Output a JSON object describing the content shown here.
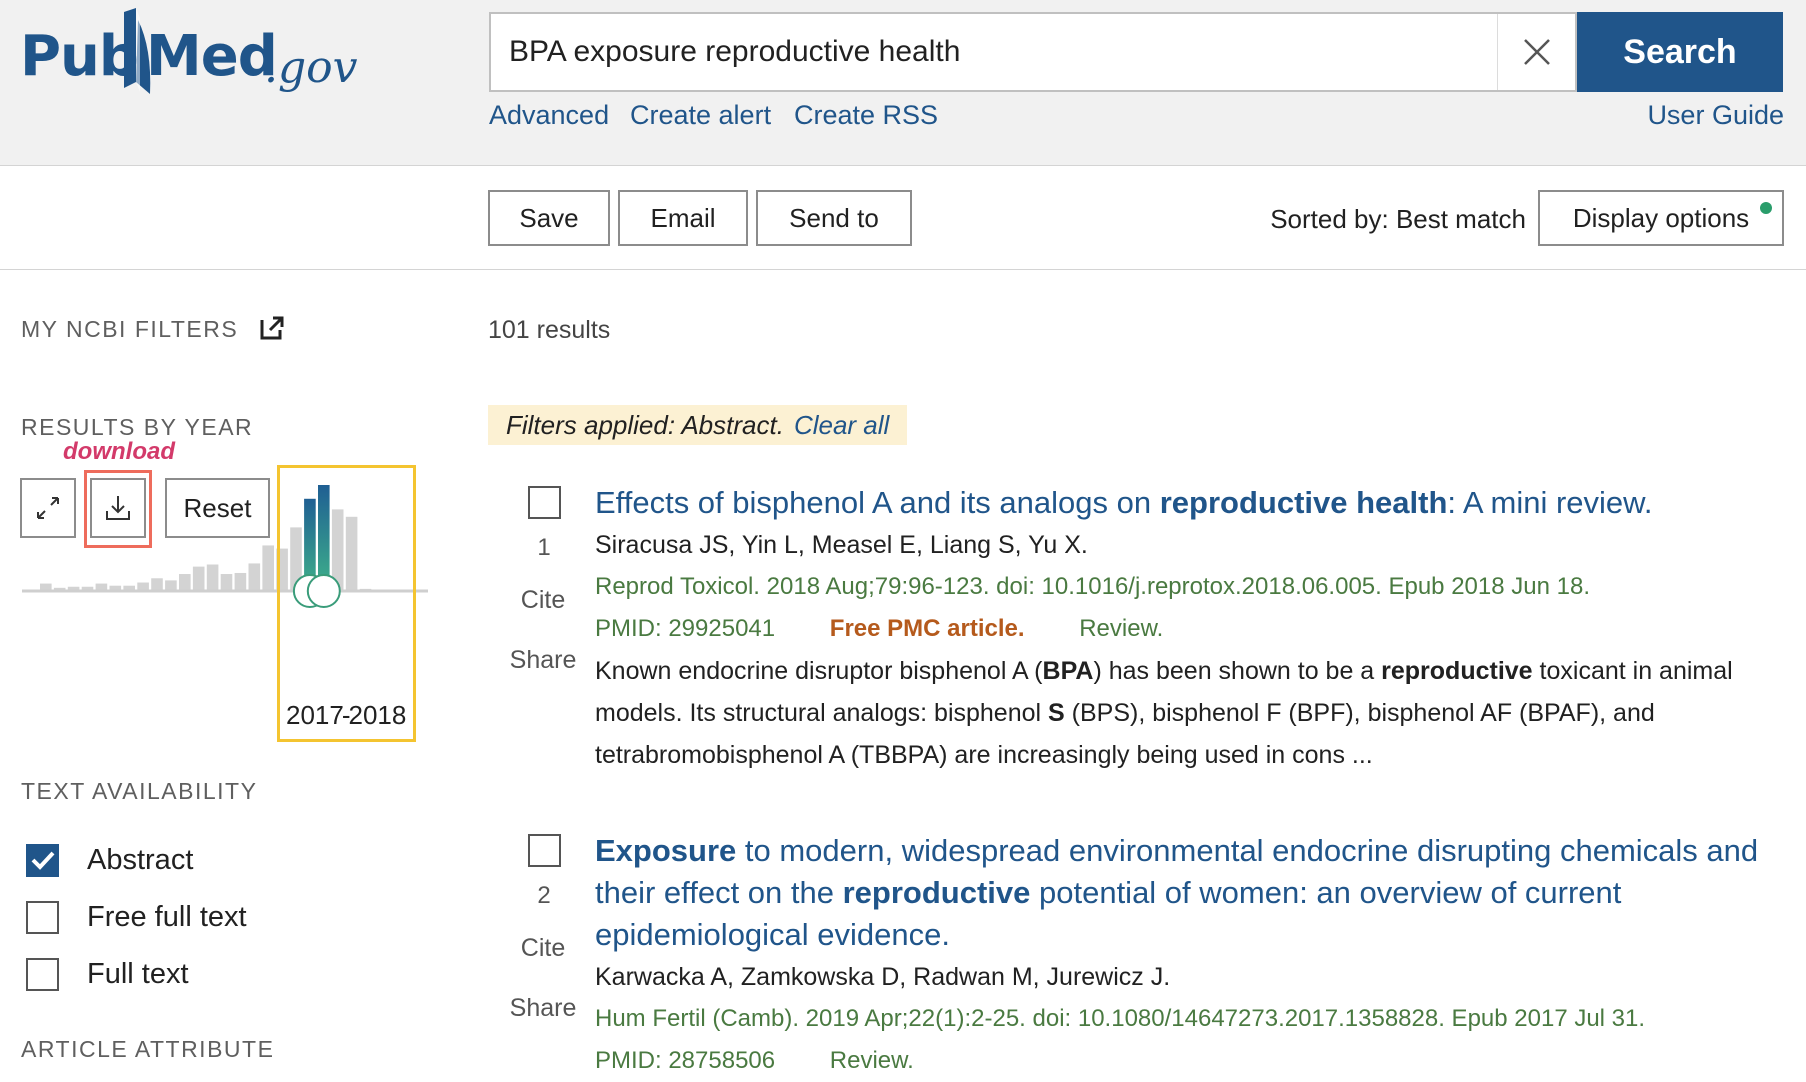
{
  "logo": {
    "pub": "Pub",
    "med": "Med",
    "gov": ".gov"
  },
  "search": {
    "query": "BPA exposure reproductive health",
    "button_label": "Search"
  },
  "header_links": {
    "advanced": "Advanced",
    "create_alert": "Create alert",
    "create_rss": "Create RSS",
    "user_guide": "User Guide"
  },
  "toolbar": {
    "save": "Save",
    "email": "Email",
    "send_to": "Send to",
    "sorted_by": "Sorted by: Best match",
    "display_options": "Display options"
  },
  "sidebar": {
    "my_ncbi_filters": "MY NCBI FILTERS",
    "results_by_year": "RESULTS BY YEAR",
    "download_annotation": "download",
    "reset": "Reset",
    "year_range_start": "2017",
    "year_range_end": "2018",
    "text_availability": "TEXT AVAILABILITY",
    "filters": [
      {
        "label": "Abstract",
        "checked": true
      },
      {
        "label": "Free full text",
        "checked": false
      },
      {
        "label": "Full text",
        "checked": false
      }
    ],
    "article_attribute": "ARTICLE ATTRIBUTE"
  },
  "results": {
    "count": "101 results",
    "filters_applied": "Filters applied: Abstract.",
    "clear_all": "Clear all",
    "cite": "Cite",
    "share": "Share",
    "items": [
      {
        "number": "1",
        "title_parts": [
          {
            "t": "Effects of bisphenol A and its analogs on ",
            "b": false
          },
          {
            "t": "reproductive health",
            "b": true
          },
          {
            "t": ": A mini review.",
            "b": false
          }
        ],
        "authors": "Siracusa JS, Yin L, Measel E, Liang S, Yu X.",
        "journal": "Reprod Toxicol. 2018 Aug;79:96-123. doi: 10.1016/j.reprotox.2018.06.005. Epub 2018 Jun 18.",
        "pmid": "PMID: 29925041",
        "free_pmc": "Free PMC article.",
        "review": "Review.",
        "snippet_parts": [
          {
            "t": "Known endocrine disruptor bisphenol A (",
            "b": false
          },
          {
            "t": "BPA",
            "b": true
          },
          {
            "t": ") has been shown to be a ",
            "b": false
          },
          {
            "t": "reproductive",
            "b": true
          },
          {
            "t": " toxicant in animal models. Its structural analogs: bisphenol ",
            "b": false
          },
          {
            "t": "S",
            "b": true
          },
          {
            "t": " (BPS), bisphenol F (BPF), bisphenol AF (BPAF), and tetrabromobisphenol A (TBBPA) are increasingly being used in cons ...",
            "b": false
          }
        ]
      },
      {
        "number": "2",
        "title_parts": [
          {
            "t": "Exposure",
            "b": true
          },
          {
            "t": " to modern, widespread environmental endocrine disrupting chemicals and their effect on the ",
            "b": false
          },
          {
            "t": "reproductive",
            "b": true
          },
          {
            "t": " potential of women: an overview of current epidemiological evidence.",
            "b": false
          }
        ],
        "authors": "Karwacka A, Zamkowska D, Radwan M, Jurewicz J.",
        "journal": "Hum Fertil (Camb). 2019 Apr;22(1):2-25. doi: 10.1080/14647273.2017.1358828. Epub 2017 Jul 31.",
        "pmid": "PMID: 28758506",
        "review": "Review."
      }
    ]
  },
  "chart_data": {
    "type": "bar",
    "values": [
      0.07,
      0.03,
      0.04,
      0.04,
      0.07,
      0.05,
      0.05,
      0.08,
      0.12,
      0.1,
      0.16,
      0.23,
      0.25,
      0.16,
      0.17,
      0.26,
      0.43,
      0.4,
      0.6,
      0.87,
      1.0,
      0.77,
      0.7,
      0.02
    ],
    "highlighted_indices": [
      19,
      20
    ],
    "colors": {
      "normal": "#d3d3d3",
      "highlight_top": "#1f5f93",
      "highlight_bottom": "#3fb28a",
      "axis": "#cfcfcf",
      "handle": "#3a9c7a"
    }
  }
}
